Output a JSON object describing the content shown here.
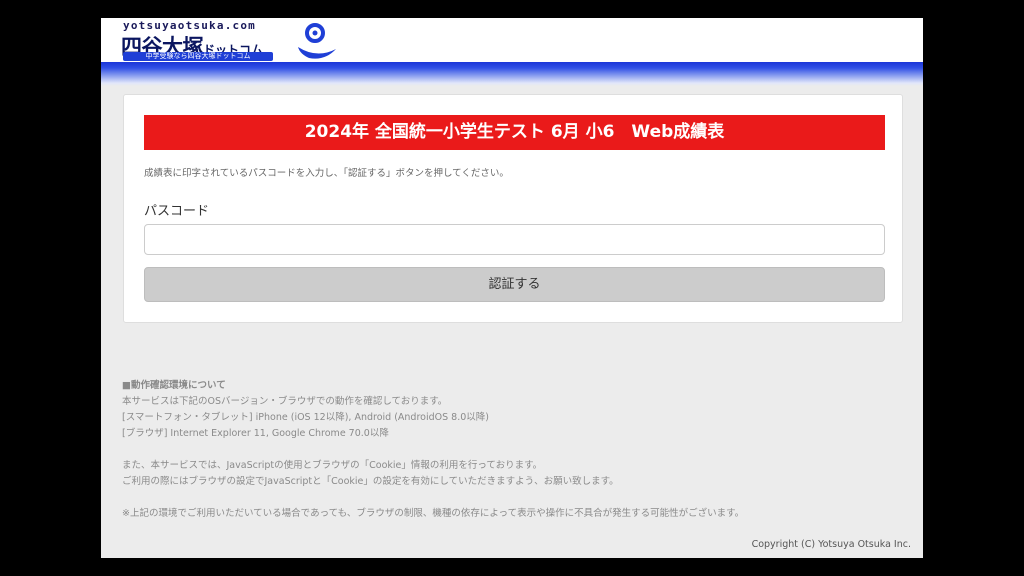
{
  "header": {
    "logo_url_text": "yotsuyaotsuka.com",
    "logo_main_text": "四谷大塚",
    "logo_sub_text": "ドットコム",
    "logo_tagline": "中学受験なら四谷大塚ドットコム",
    "brand_colors": {
      "navy": "#0b1660",
      "blue": "#1f3fd6"
    },
    "logo_mark_icon": "mascot-logo-icon"
  },
  "form": {
    "title": "2024年 全国統一小学生テスト 6月 小6　Web成績表",
    "title_color": "#ea1a1a",
    "instruction": "成績表に印字されているパスコードを入力し、「認証する」ボタンを押してください。",
    "passcode_label": "パスコード",
    "passcode_value": "",
    "submit_label": "認証する"
  },
  "notes": {
    "heading": "■動作確認環境について",
    "lines": [
      "本サービスは下記のOSバージョン・ブラウザでの動作を確認しております。",
      "[スマートフォン・タブレット] iPhone (iOS 12以降), Android (AndroidOS 8.0以降)",
      "[ブラウザ] Internet Explorer 11, Google Chrome 70.0以降"
    ],
    "cookie_lines": [
      "また、本サービスでは、JavaScriptの使用とブラウザの「Cookie」情報の利用を行っております。",
      "ご利用の際にはブラウザの設定でJavaScriptと「Cookie」の設定を有効にしていただきますよう、お願い致します。"
    ],
    "warning": "※上記の環境でご利用いただいている場合であっても、ブラウザの制限、機種の依存によって表示や操作に不具合が発生する可能性がございます。"
  },
  "footer": {
    "copyright": "Copyright (C) Yotsuya Otsuka Inc."
  }
}
